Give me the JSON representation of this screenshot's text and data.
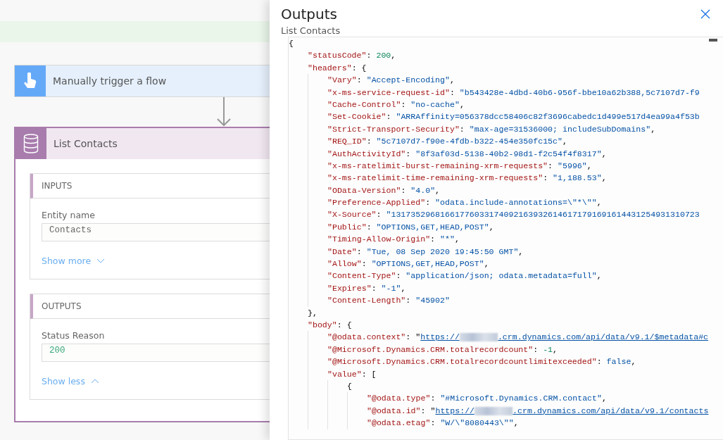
{
  "flow": {
    "trigger": {
      "title": "Manually trigger a flow"
    },
    "action": {
      "title": "List Contacts",
      "sections": [
        {
          "title": "INPUTS",
          "fields": [
            {
              "label": "Entity name",
              "value": "Contacts",
              "kind": "text"
            }
          ],
          "toggle": {
            "label": "Show more",
            "expanded": false
          }
        },
        {
          "title": "OUTPUTS",
          "fields": [
            {
              "label": "Status Reason",
              "value": "200",
              "kind": "number"
            }
          ],
          "toggle": {
            "label": "Show less",
            "expanded": true
          }
        }
      ]
    }
  },
  "panel": {
    "title": "Outputs",
    "subtitle": "List Contacts",
    "code": [
      {
        "parts": [
          {
            "kind": "punct",
            "text": "{"
          }
        ],
        "children": [
          {
            "parts": [
              {
                "kind": "key",
                "text": "\"statusCode\""
              },
              {
                "kind": "punct",
                "text": ": "
              },
              {
                "kind": "number",
                "text": "200"
              },
              {
                "kind": "punct",
                "text": ","
              }
            ]
          },
          {
            "parts": [
              {
                "kind": "key",
                "text": "\"headers\""
              },
              {
                "kind": "punct",
                "text": ": {"
              }
            ],
            "children": [
              {
                "parts": [
                  {
                    "kind": "key",
                    "text": "\"Vary\""
                  },
                  {
                    "kind": "punct",
                    "text": ": "
                  },
                  {
                    "kind": "string",
                    "text": "\"Accept-Encoding\""
                  },
                  {
                    "kind": "punct",
                    "text": ","
                  }
                ]
              },
              {
                "parts": [
                  {
                    "kind": "key",
                    "text": "\"x-ms-service-request-id\""
                  },
                  {
                    "kind": "punct",
                    "text": ": "
                  },
                  {
                    "kind": "string",
                    "text": "\"b543428e-4dbd-40b6-956f-bbe10a62b388,5c7107d7-f9"
                  }
                ]
              },
              {
                "parts": [
                  {
                    "kind": "key",
                    "text": "\"Cache-Control\""
                  },
                  {
                    "kind": "punct",
                    "text": ": "
                  },
                  {
                    "kind": "string",
                    "text": "\"no-cache\""
                  },
                  {
                    "kind": "punct",
                    "text": ","
                  }
                ]
              },
              {
                "parts": [
                  {
                    "kind": "key",
                    "text": "\"Set-Cookie\""
                  },
                  {
                    "kind": "punct",
                    "text": ": "
                  },
                  {
                    "kind": "string",
                    "text": "\"ARRAffinity=056378dcc58406c82f3696cabedc1d499e517d4ea99a4f53b"
                  }
                ]
              },
              {
                "parts": [
                  {
                    "kind": "key",
                    "text": "\"Strict-Transport-Security\""
                  },
                  {
                    "kind": "punct",
                    "text": ": "
                  },
                  {
                    "kind": "string",
                    "text": "\"max-age=31536000; includeSubDomains\""
                  },
                  {
                    "kind": "punct",
                    "text": ","
                  }
                ]
              },
              {
                "parts": [
                  {
                    "kind": "key",
                    "text": "\"REQ_ID\""
                  },
                  {
                    "kind": "punct",
                    "text": ": "
                  },
                  {
                    "kind": "string",
                    "text": "\"5c7107d7-f90e-4fdb-b322-454e350fc15c\""
                  },
                  {
                    "kind": "punct",
                    "text": ","
                  }
                ]
              },
              {
                "parts": [
                  {
                    "kind": "key",
                    "text": "\"AuthActivityId\""
                  },
                  {
                    "kind": "punct",
                    "text": ": "
                  },
                  {
                    "kind": "string",
                    "text": "\"8f3af03d-5138-40b2-98d1-f2c54f4f8317\""
                  },
                  {
                    "kind": "punct",
                    "text": ","
                  }
                ]
              },
              {
                "parts": [
                  {
                    "kind": "key",
                    "text": "\"x-ms-ratelimit-burst-remaining-xrm-requests\""
                  },
                  {
                    "kind": "punct",
                    "text": ": "
                  },
                  {
                    "kind": "string",
                    "text": "\"5996\""
                  },
                  {
                    "kind": "punct",
                    "text": ","
                  }
                ]
              },
              {
                "parts": [
                  {
                    "kind": "key",
                    "text": "\"x-ms-ratelimit-time-remaining-xrm-requests\""
                  },
                  {
                    "kind": "punct",
                    "text": ": "
                  },
                  {
                    "kind": "string",
                    "text": "\"1,188.53\""
                  },
                  {
                    "kind": "punct",
                    "text": ","
                  }
                ]
              },
              {
                "parts": [
                  {
                    "kind": "key",
                    "text": "\"OData-Version\""
                  },
                  {
                    "kind": "punct",
                    "text": ": "
                  },
                  {
                    "kind": "string",
                    "text": "\"4.0\""
                  },
                  {
                    "kind": "punct",
                    "text": ","
                  }
                ]
              },
              {
                "parts": [
                  {
                    "kind": "key",
                    "text": "\"Preference-Applied\""
                  },
                  {
                    "kind": "punct",
                    "text": ": "
                  },
                  {
                    "kind": "string",
                    "text": "\"odata.include-annotations=\\\"*\\\"\""
                  },
                  {
                    "kind": "punct",
                    "text": ","
                  }
                ]
              },
              {
                "parts": [
                  {
                    "kind": "key",
                    "text": "\"X-Source\""
                  },
                  {
                    "kind": "punct",
                    "text": ": "
                  },
                  {
                    "kind": "string",
                    "text": "\"131735296816617760331740921639326146171791691614431254931310723"
                  }
                ]
              },
              {
                "parts": [
                  {
                    "kind": "key",
                    "text": "\"Public\""
                  },
                  {
                    "kind": "punct",
                    "text": ": "
                  },
                  {
                    "kind": "string",
                    "text": "\"OPTIONS,GET,HEAD,POST\""
                  },
                  {
                    "kind": "punct",
                    "text": ","
                  }
                ]
              },
              {
                "parts": [
                  {
                    "kind": "key",
                    "text": "\"Timing-Allow-Origin\""
                  },
                  {
                    "kind": "punct",
                    "text": ": "
                  },
                  {
                    "kind": "string",
                    "text": "\"*\""
                  },
                  {
                    "kind": "punct",
                    "text": ","
                  }
                ]
              },
              {
                "parts": [
                  {
                    "kind": "key",
                    "text": "\"Date\""
                  },
                  {
                    "kind": "punct",
                    "text": ": "
                  },
                  {
                    "kind": "string",
                    "text": "\"Tue, 08 Sep 2020 19:45:50 GMT\""
                  },
                  {
                    "kind": "punct",
                    "text": ","
                  }
                ]
              },
              {
                "parts": [
                  {
                    "kind": "key",
                    "text": "\"Allow\""
                  },
                  {
                    "kind": "punct",
                    "text": ": "
                  },
                  {
                    "kind": "string",
                    "text": "\"OPTIONS,GET,HEAD,POST\""
                  },
                  {
                    "kind": "punct",
                    "text": ","
                  }
                ]
              },
              {
                "parts": [
                  {
                    "kind": "key",
                    "text": "\"Content-Type\""
                  },
                  {
                    "kind": "punct",
                    "text": ": "
                  },
                  {
                    "kind": "string",
                    "text": "\"application/json; odata.metadata=full\""
                  },
                  {
                    "kind": "punct",
                    "text": ","
                  }
                ]
              },
              {
                "parts": [
                  {
                    "kind": "key",
                    "text": "\"Expires\""
                  },
                  {
                    "kind": "punct",
                    "text": ": "
                  },
                  {
                    "kind": "string",
                    "text": "\"-1\""
                  },
                  {
                    "kind": "punct",
                    "text": ","
                  }
                ]
              },
              {
                "parts": [
                  {
                    "kind": "key",
                    "text": "\"Content-Length\""
                  },
                  {
                    "kind": "punct",
                    "text": ": "
                  },
                  {
                    "kind": "string",
                    "text": "\"45902\""
                  }
                ]
              }
            ]
          },
          {
            "parts": [
              {
                "kind": "punct",
                "text": "},"
              }
            ]
          },
          {
            "parts": [
              {
                "kind": "key",
                "text": "\"body\""
              },
              {
                "kind": "punct",
                "text": ": {"
              }
            ],
            "children": [
              {
                "parts": [
                  {
                    "kind": "key",
                    "text": "\"@odata.context\""
                  },
                  {
                    "kind": "punct",
                    "text": ": "
                  },
                  {
                    "kind": "punct",
                    "text": "\""
                  },
                  {
                    "kind": "link",
                    "text": "https://",
                    "after": ".crm.dynamics.com/api/data/v9.1/$metadata#c",
                    "redacted": true
                  }
                ]
              },
              {
                "parts": [
                  {
                    "kind": "key",
                    "text": "\"@Microsoft.Dynamics.CRM.totalrecordcount\""
                  },
                  {
                    "kind": "punct",
                    "text": ": "
                  },
                  {
                    "kind": "number",
                    "text": "-1"
                  },
                  {
                    "kind": "punct",
                    "text": ","
                  }
                ]
              },
              {
                "parts": [
                  {
                    "kind": "key",
                    "text": "\"@Microsoft.Dynamics.CRM.totalrecordcountlimitexceeded\""
                  },
                  {
                    "kind": "punct",
                    "text": ": "
                  },
                  {
                    "kind": "bool",
                    "text": "false"
                  },
                  {
                    "kind": "punct",
                    "text": ","
                  }
                ]
              },
              {
                "parts": [
                  {
                    "kind": "key",
                    "text": "\"value\""
                  },
                  {
                    "kind": "punct",
                    "text": ": ["
                  }
                ],
                "children": [
                  {
                    "parts": [
                      {
                        "kind": "punct",
                        "text": "{"
                      }
                    ],
                    "children": [
                      {
                        "parts": [
                          {
                            "kind": "key",
                            "text": "\"@odata.type\""
                          },
                          {
                            "kind": "punct",
                            "text": ": "
                          },
                          {
                            "kind": "string",
                            "text": "\"#Microsoft.Dynamics.CRM.contact\""
                          },
                          {
                            "kind": "punct",
                            "text": ","
                          }
                        ]
                      },
                      {
                        "parts": [
                          {
                            "kind": "key",
                            "text": "\"@odata.id\""
                          },
                          {
                            "kind": "punct",
                            "text": ": "
                          },
                          {
                            "kind": "punct",
                            "text": "\""
                          },
                          {
                            "kind": "link",
                            "text": "https://",
                            "after": ".crm.dynamics.com/api/data/v9.1/contacts",
                            "redacted": true
                          }
                        ]
                      },
                      {
                        "parts": [
                          {
                            "kind": "key",
                            "text": "\"@odata.etag\""
                          },
                          {
                            "kind": "punct",
                            "text": ": "
                          },
                          {
                            "kind": "string",
                            "text": "\"W/\\\"8080443\\\"\""
                          },
                          {
                            "kind": "punct",
                            "text": ","
                          }
                        ]
                      }
                    ]
                  }
                ]
              }
            ]
          }
        ]
      }
    ]
  }
}
